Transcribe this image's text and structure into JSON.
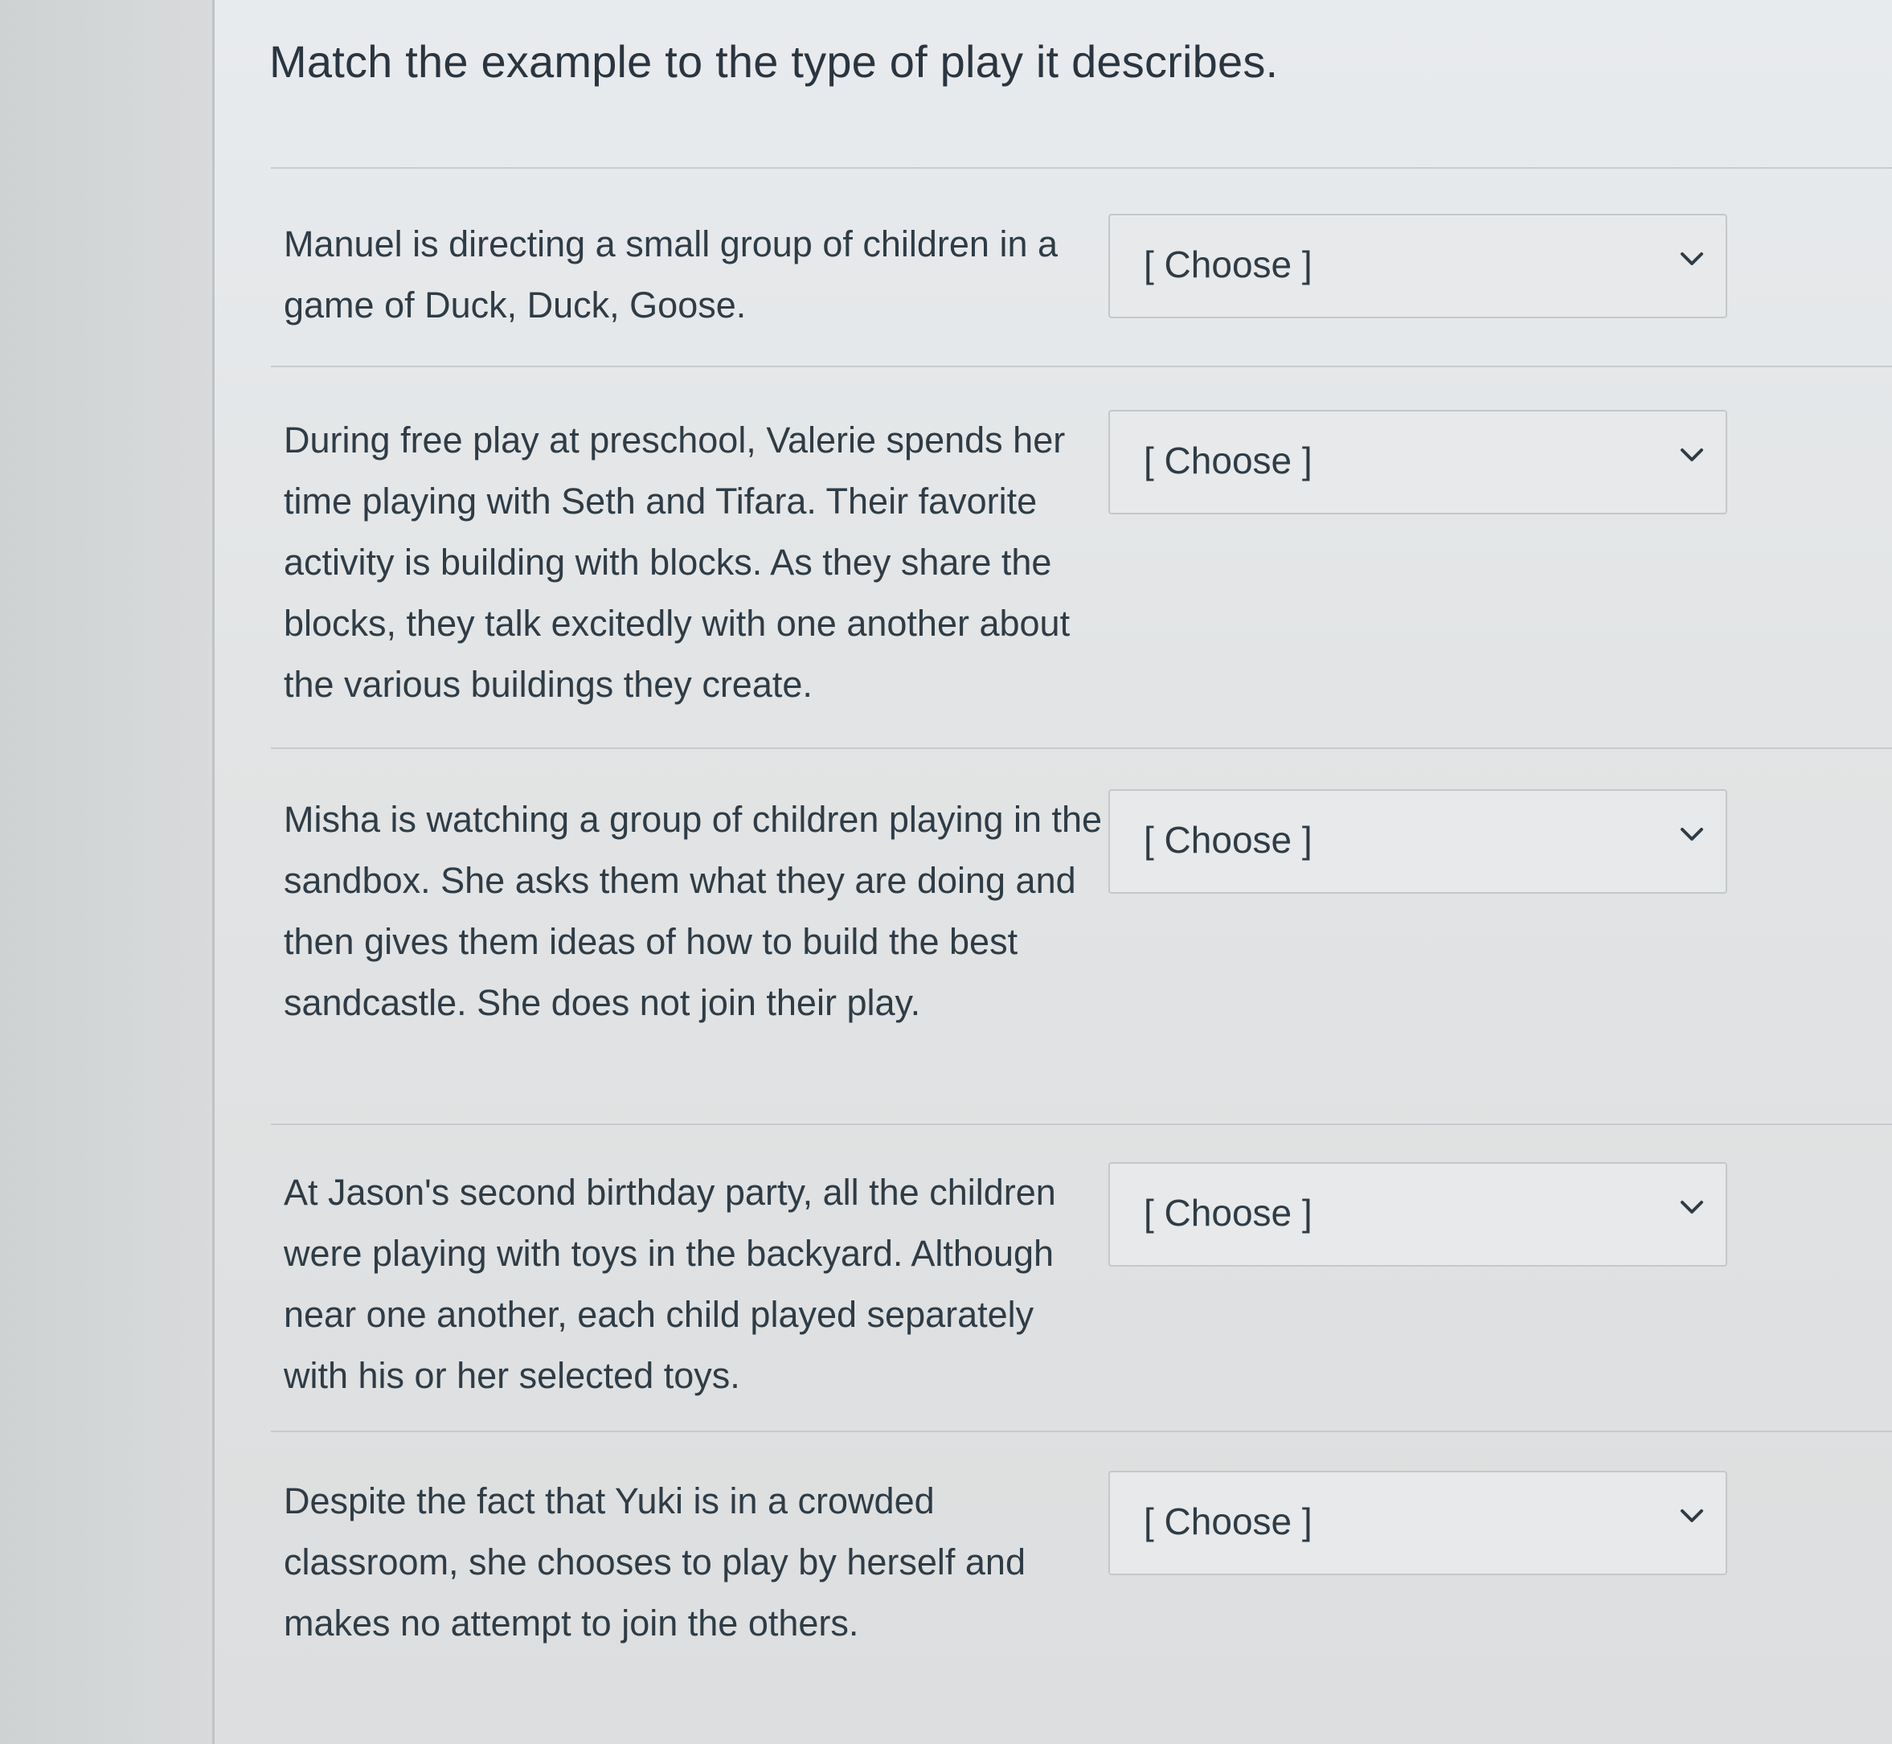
{
  "question": {
    "text": "Match the example to the type of play it describes."
  },
  "items": [
    {
      "example": "Manuel is directing a small group of children in a game of Duck, Duck, Goose.",
      "selected": "[ Choose ]"
    },
    {
      "example": "During free play at preschool, Valerie spends her time playing with Seth and Tifara. Their favorite activity is building with blocks. As they share the blocks, they talk excitedly with one another about the various buildings they create.",
      "selected": "[ Choose ]"
    },
    {
      "example": "Misha is watching a group of children playing in the sandbox. She asks them what they are doing and then gives them ideas of how to build the best sandcastle. She does not join their play.",
      "selected": "[ Choose ]"
    },
    {
      "example": "At Jason's second birthday party, all the children were playing with toys in the backyard. Although near one another, each child played separately with his or her selected toys.",
      "selected": "[ Choose ]"
    },
    {
      "example": "Despite the fact that Yuki is in a crowded classroom, she chooses to play by herself and makes no attempt to join the others.",
      "selected": "[ Choose ]"
    }
  ],
  "icons": {
    "dropdown": "chevron-down-icon"
  }
}
